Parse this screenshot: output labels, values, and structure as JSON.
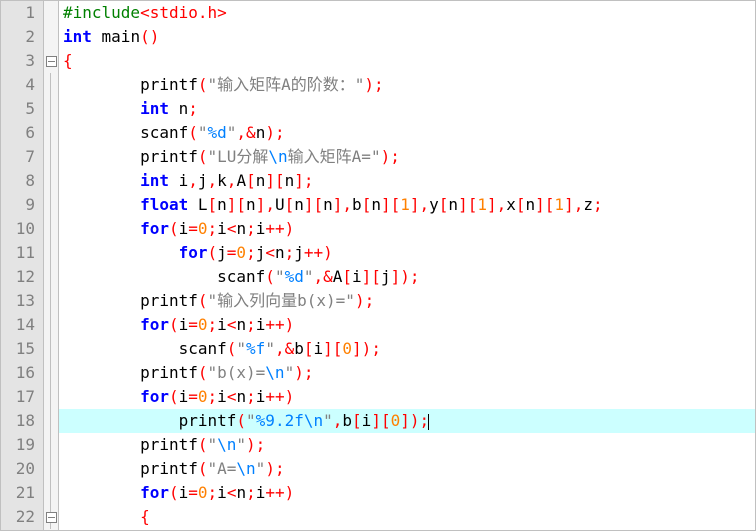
{
  "lines": [
    "1",
    "2",
    "3",
    "4",
    "5",
    "6",
    "7",
    "8",
    "9",
    "10",
    "11",
    "12",
    "13",
    "14",
    "15",
    "16",
    "17",
    "18",
    "19",
    "20",
    "21",
    "22"
  ],
  "c": {
    "l1a": "#include",
    "l1b": "<stdio.h>",
    "l2a": "int",
    "l2b": " main",
    "l2c": "()",
    "l3": "{",
    "l4a": "        printf",
    "l4b": "(",
    "l4c": "\"输入矩阵A的阶数：\"",
    "l4d": ");",
    "l5a": "        ",
    "l5b": "int",
    "l5c": " n",
    "l5d": ";",
    "l6a": "        scanf",
    "l6b": "(",
    "l6c": "\"",
    "l6d": "%d",
    "l6e": "\"",
    "l6f": ",&",
    "l6g": "n",
    "l6h": ");",
    "l7a": "        printf",
    "l7b": "(",
    "l7c": "\"LU分解",
    "l7d": "\\n",
    "l7e": "输入矩阵A=\"",
    "l7f": ");",
    "l8a": "        ",
    "l8b": "int",
    "l8c": " i",
    "l8d": ",",
    "l8e": "j",
    "l8f": ",",
    "l8g": "k",
    "l8h": ",",
    "l8i": "A",
    "l8j": "[",
    "l8k": "n",
    "l8l": "][",
    "l8m": "n",
    "l8n": "];",
    "l9a": "        ",
    "l9b": "float",
    "l9c": " L",
    "l9d": "[",
    "l9e": "n",
    "l9f": "][",
    "l9g": "n",
    "l9h": "],",
    "l9i": "U",
    "l9j": "[",
    "l9k": "n",
    "l9l": "][",
    "l9m": "n",
    "l9n": "],",
    "l9o": "b",
    "l9p": "[",
    "l9q": "n",
    "l9r": "][",
    "l9s": "1",
    "l9t": "],",
    "l9u": "y",
    "l9v": "[",
    "l9w": "n",
    "l9x": "][",
    "l9y": "1",
    "l9z": "],",
    "l9A": "x",
    "l9B": "[",
    "l9C": "n",
    "l9D": "][",
    "l9E": "1",
    "l9F": "],",
    "l9G": "z",
    "l9H": ";",
    "l10a": "        ",
    "l10b": "for",
    "l10c": "(",
    "l10d": "i",
    "l10e": "=",
    "l10f": "0",
    "l10g": ";",
    "l10h": "i",
    "l10i": "<",
    "l10j": "n",
    "l10k": ";",
    "l10l": "i",
    "l10m": "++)",
    "l11a": "            ",
    "l11b": "for",
    "l11c": "(",
    "l11d": "j",
    "l11e": "=",
    "l11f": "0",
    "l11g": ";",
    "l11h": "j",
    "l11i": "<",
    "l11j": "n",
    "l11k": ";",
    "l11l": "j",
    "l11m": "++)",
    "l12a": "                scanf",
    "l12b": "(",
    "l12c": "\"",
    "l12d": "%d",
    "l12e": "\"",
    "l12f": ",&",
    "l12g": "A",
    "l12h": "[",
    "l12i": "i",
    "l12j": "][",
    "l12k": "j",
    "l12l": "]);",
    "l13a": "        printf",
    "l13b": "(",
    "l13c": "\"输入列向量b(x)=\"",
    "l13d": ");",
    "l14a": "        ",
    "l14b": "for",
    "l14c": "(",
    "l14d": "i",
    "l14e": "=",
    "l14f": "0",
    "l14g": ";",
    "l14h": "i",
    "l14i": "<",
    "l14j": "n",
    "l14k": ";",
    "l14l": "i",
    "l14m": "++)",
    "l15a": "            scanf",
    "l15b": "(",
    "l15c": "\"",
    "l15d": "%f",
    "l15e": "\"",
    "l15f": ",&",
    "l15g": "b",
    "l15h": "[",
    "l15i": "i",
    "l15j": "][",
    "l15k": "0",
    "l15l": "]);",
    "l16a": "        printf",
    "l16b": "(",
    "l16c": "\"b(x)=",
    "l16d": "\\n",
    "l16e": "\"",
    "l16f": ");",
    "l17a": "        ",
    "l17b": "for",
    "l17c": "(",
    "l17d": "i",
    "l17e": "=",
    "l17f": "0",
    "l17g": ";",
    "l17h": "i",
    "l17i": "<",
    "l17j": "n",
    "l17k": ";",
    "l17l": "i",
    "l17m": "++)",
    "l18a": "            printf",
    "l18b": "(",
    "l18c": "\"",
    "l18d": "%9.2f\\n",
    "l18e": "\"",
    "l18f": ",",
    "l18g": "b",
    "l18h": "[",
    "l18i": "i",
    "l18j": "][",
    "l18k": "0",
    "l18l": "]);",
    "l19a": "        printf",
    "l19b": "(",
    "l19c": "\"",
    "l19d": "\\n",
    "l19e": "\"",
    "l19f": ");",
    "l20a": "        printf",
    "l20b": "(",
    "l20c": "\"A=",
    "l20d": "\\n",
    "l20e": "\"",
    "l20f": ");",
    "l21a": "        ",
    "l21b": "for",
    "l21c": "(",
    "l21d": "i",
    "l21e": "=",
    "l21f": "0",
    "l21g": ";",
    "l21h": "i",
    "l21i": "<",
    "l21j": "n",
    "l21k": ";",
    "l21l": "i",
    "l21m": "++)",
    "l22": "        {"
  }
}
